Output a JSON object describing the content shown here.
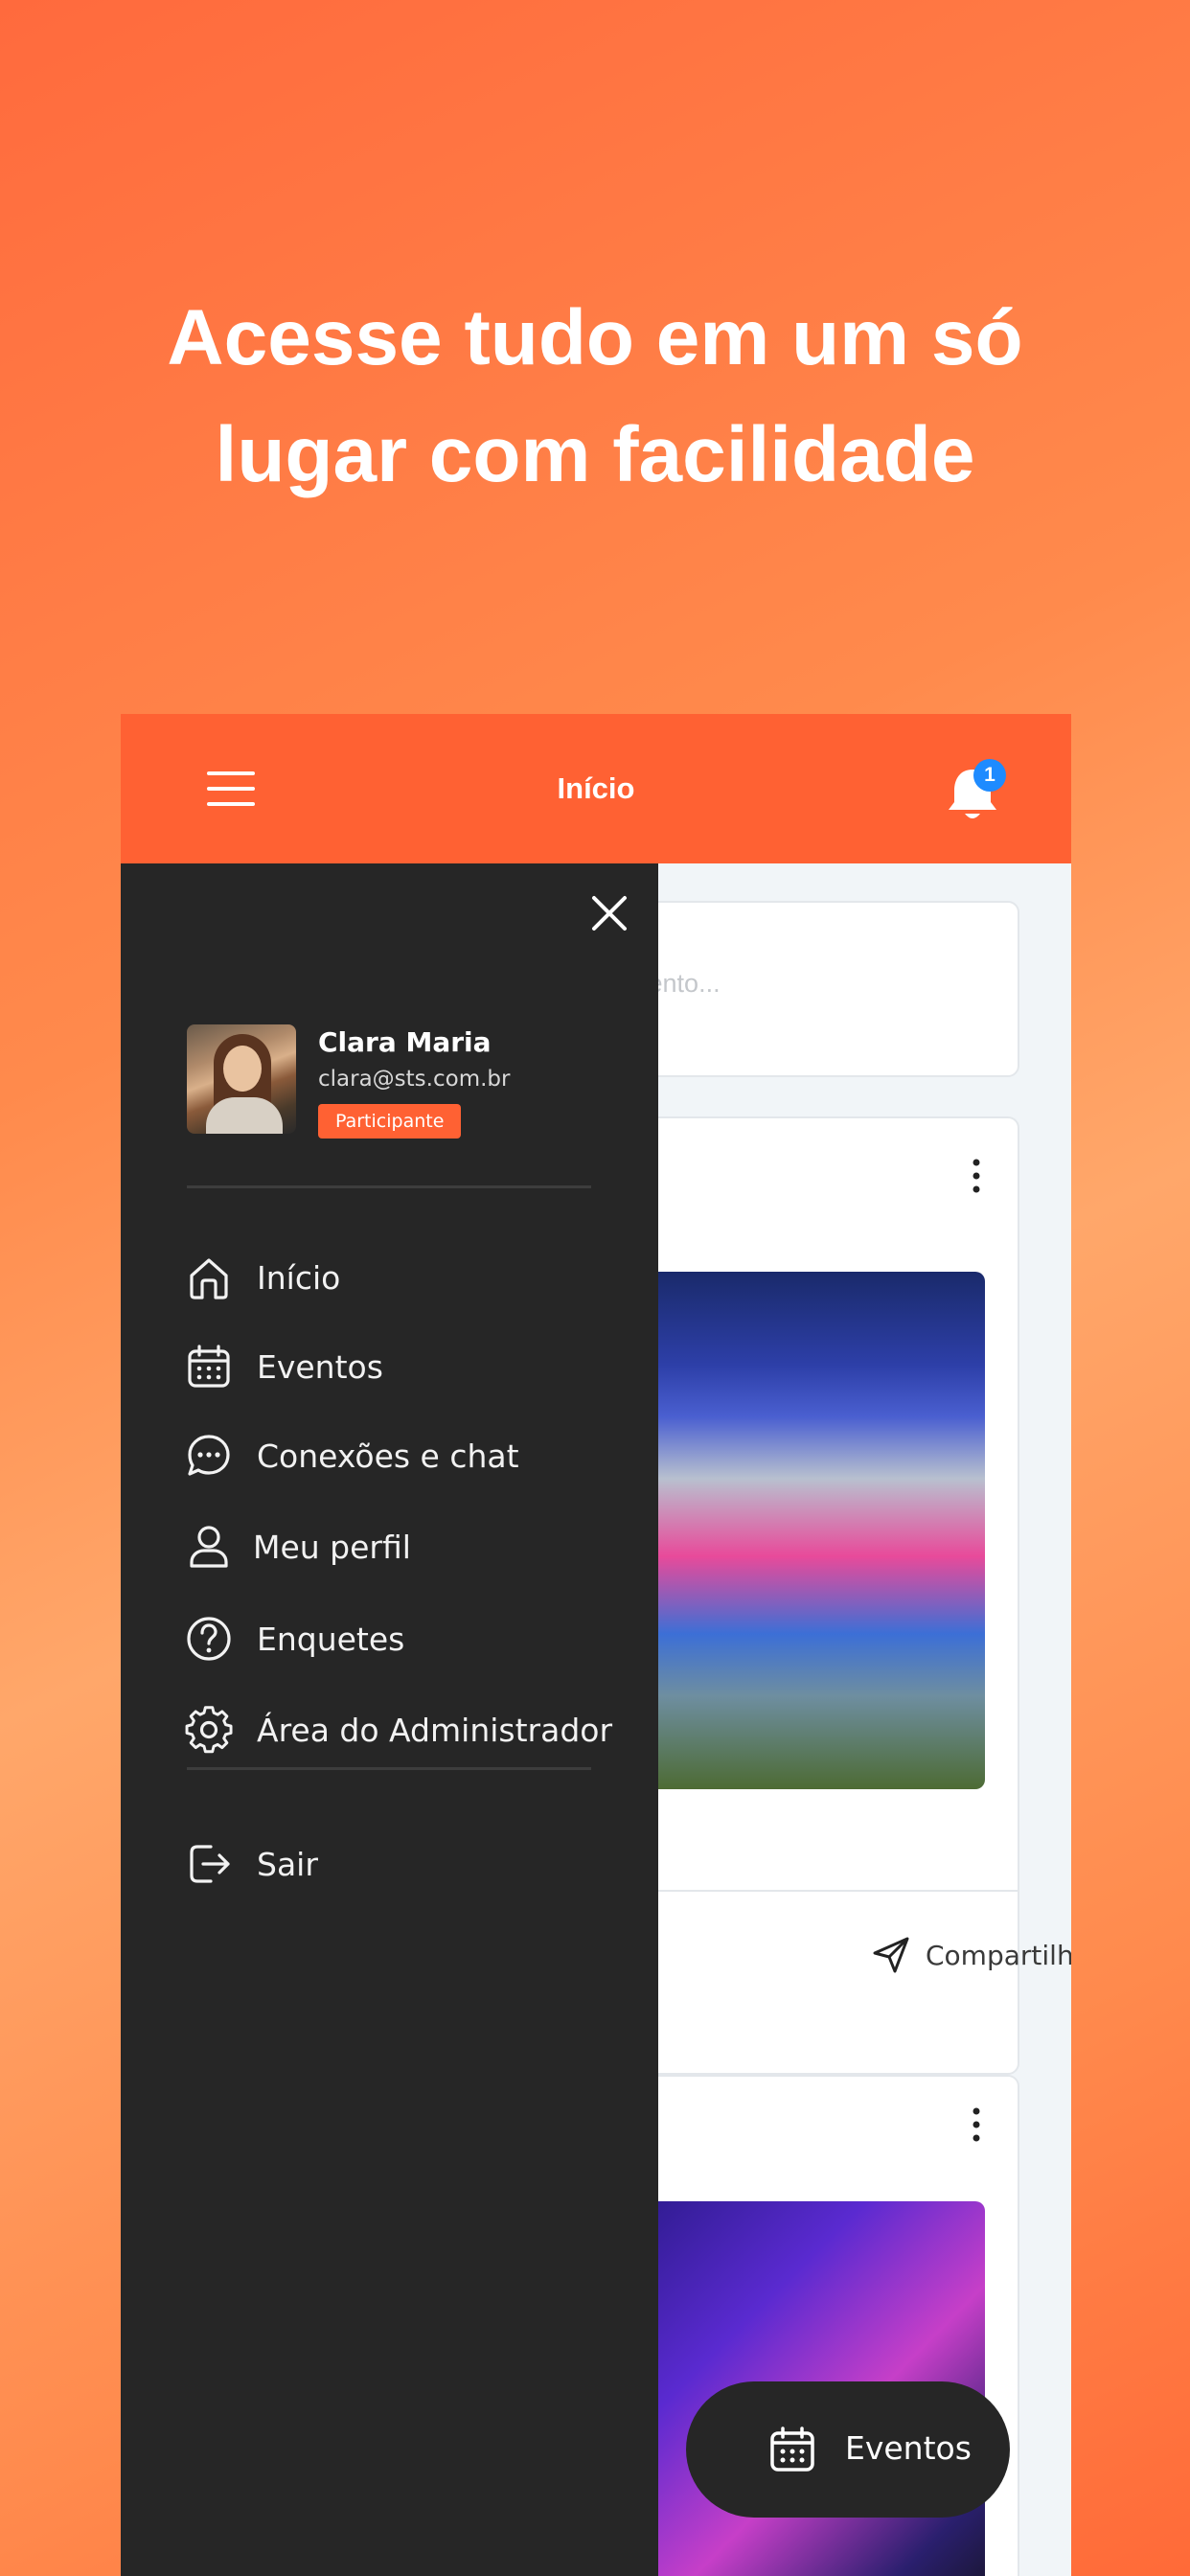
{
  "headline": {
    "line1": "Acesse tudo em um só",
    "line2": "lugar com facilidade"
  },
  "appbar": {
    "title": "Início",
    "notification_count": "1"
  },
  "feed": {
    "search_placeholder": "evento...",
    "share_label": "Compartilhar"
  },
  "fab": {
    "label": "Eventos"
  },
  "drawer": {
    "user": {
      "name": "Clara Maria",
      "email": "clara@sts.com.br",
      "role": "Participante"
    },
    "items": [
      {
        "label": "Início",
        "icon": "home-icon"
      },
      {
        "label": "Eventos",
        "icon": "calendar-icon"
      },
      {
        "label": "Conexões e chat",
        "icon": "chat-icon"
      },
      {
        "label": "Meu perfil",
        "icon": "user-icon"
      },
      {
        "label": "Enquetes",
        "icon": "question-icon"
      },
      {
        "label": "Área do Administrador",
        "icon": "gear-icon"
      }
    ],
    "logout_label": "Sair"
  },
  "colors": {
    "accent": "#ff6133",
    "drawer_bg": "#262626",
    "badge": "#1e8bff"
  }
}
